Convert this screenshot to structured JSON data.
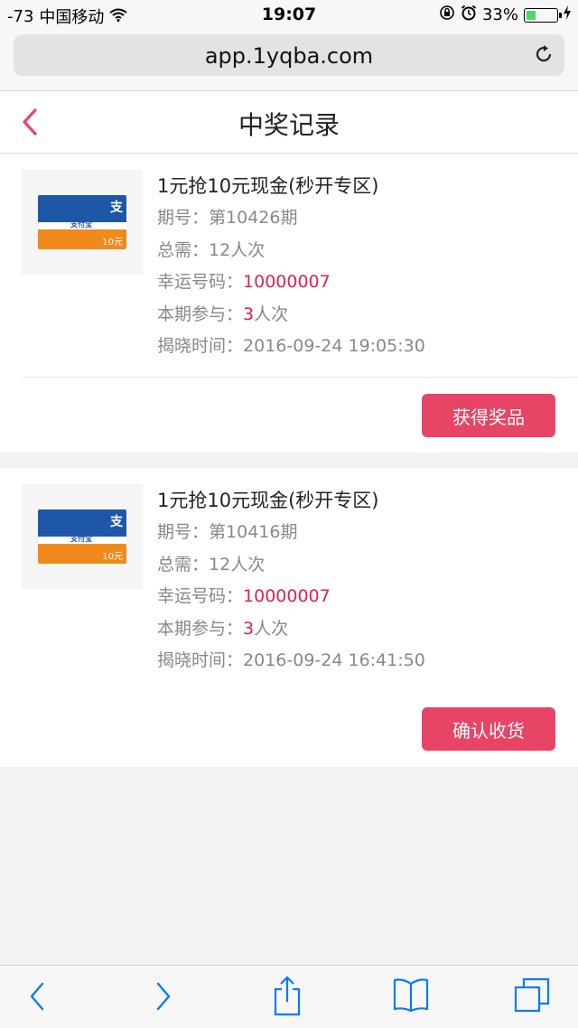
{
  "status_bar": {
    "signal": "-73",
    "carrier": "中国移动",
    "time": "19:07",
    "battery": "33%",
    "battery_level": 0.33
  },
  "browser": {
    "url": "app.1yqba.com"
  },
  "header": {
    "title": "中奖记录"
  },
  "records": [
    {
      "title": "1元抢10元现金(秒开专区)",
      "issue_label": "期号：",
      "issue_value": "第10426期",
      "total_label": "总需：",
      "total_value": "12人次",
      "lucky_label": "幸运号码：",
      "lucky_value": "10000007",
      "joined_label": "本期参与：",
      "joined_count": "3",
      "joined_unit": "人次",
      "reveal_label": "揭晓时间：",
      "reveal_value": "2016-09-24 19:05:30",
      "button_label": "获得奖品",
      "card_brand": "支付宝",
      "card_value": "10元",
      "card_zhi": "支"
    },
    {
      "title": "1元抢10元现金(秒开专区)",
      "issue_label": "期号：",
      "issue_value": "第10416期",
      "total_label": "总需：",
      "total_value": "12人次",
      "lucky_label": "幸运号码：",
      "lucky_value": "10000007",
      "joined_label": "本期参与：",
      "joined_count": "3",
      "joined_unit": "人次",
      "reveal_label": "揭晓时间：",
      "reveal_value": "2016-09-24 16:41:50",
      "button_label": "确认收货",
      "card_brand": "支付宝",
      "card_value": "10元",
      "card_zhi": "支"
    }
  ],
  "colors": {
    "accent": "#e84466",
    "highlight": "#e0224c",
    "ios_blue": "#0a7aff"
  }
}
